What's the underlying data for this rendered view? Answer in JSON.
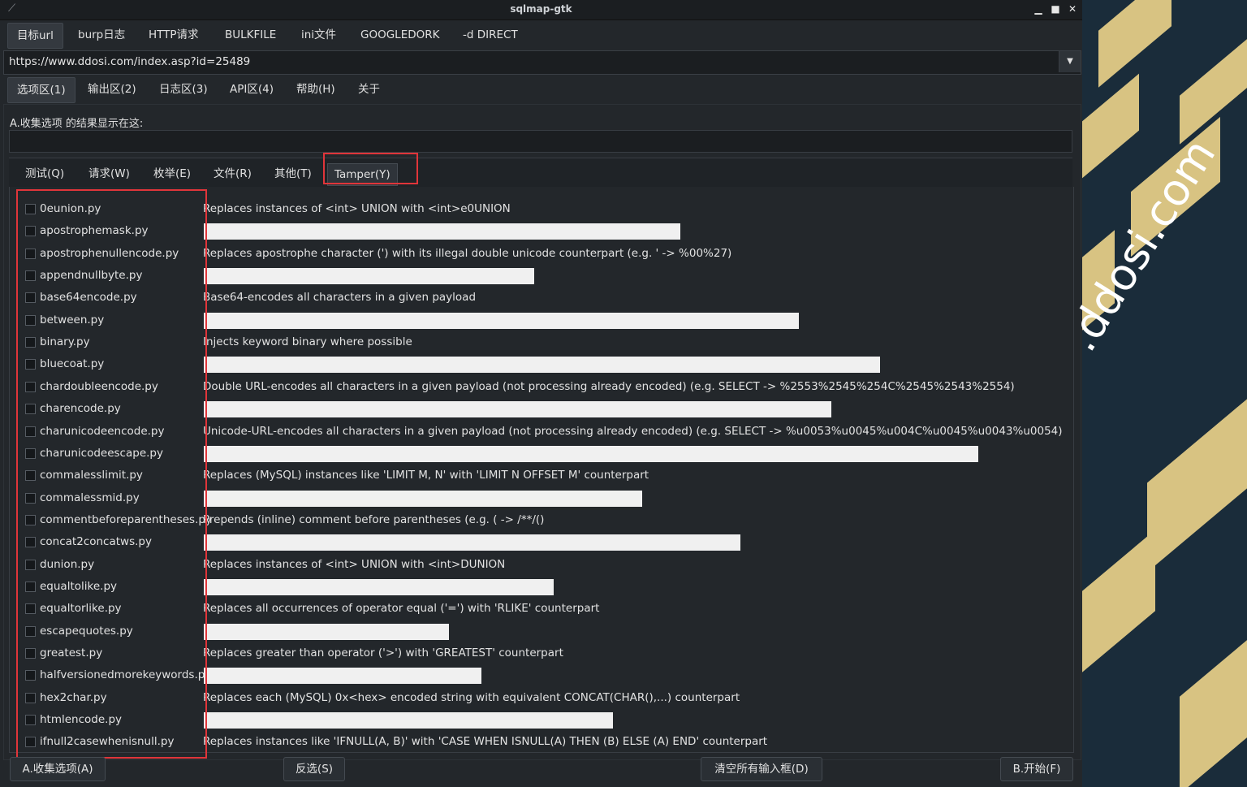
{
  "window": {
    "title": "sqlmap-gtk"
  },
  "top_tabs": [
    "目标url",
    "burp日志",
    "HTTP请求",
    "BULKFILE",
    "ini文件",
    "GOOGLEDORK",
    "-d DIRECT"
  ],
  "url": {
    "value": "https://www.ddosi.com/index.asp?id=25489"
  },
  "section_tabs": [
    "选项区(1)",
    "输出区(2)",
    "日志区(3)",
    "API区(4)",
    "帮助(H)",
    "关于"
  ],
  "collect": {
    "label": "A.收集选项 的结果显示在这:"
  },
  "inner_tabs": [
    "测试(Q)",
    "请求(W)",
    "枚举(E)",
    "文件(R)",
    "其他(T)",
    "Tamper(Y)"
  ],
  "tampers": [
    {
      "name": "0eunion.py",
      "desc": "Replaces instances of <int> UNION with <int>e0UNION"
    },
    {
      "name": "apostrophemask.py",
      "desc": ""
    },
    {
      "name": "apostrophenullencode.py",
      "desc": "Replaces apostrophe character (') with its illegal double unicode counterpart (e.g. ' -> %00%27)"
    },
    {
      "name": "appendnullbyte.py",
      "desc": ""
    },
    {
      "name": "base64encode.py",
      "desc": "Base64-encodes all characters in a given payload"
    },
    {
      "name": "between.py",
      "desc": ""
    },
    {
      "name": "binary.py",
      "desc": "Injects keyword binary where possible"
    },
    {
      "name": "bluecoat.py",
      "desc": ""
    },
    {
      "name": "chardoubleencode.py",
      "desc": "Double URL-encodes all characters in a given payload (not processing already encoded) (e.g. SELECT -> %2553%2545%254C%2545%2543%2554)"
    },
    {
      "name": "charencode.py",
      "desc": ""
    },
    {
      "name": "charunicodeencode.py",
      "desc": "Unicode-URL-encodes all characters in a given payload (not processing already encoded) (e.g. SELECT -> %u0053%u0045%u004C%u0045%u0043%u0054)"
    },
    {
      "name": "charunicodeescape.py",
      "desc": ""
    },
    {
      "name": "commalesslimit.py",
      "desc": "Replaces (MySQL) instances like 'LIMIT M, N' with 'LIMIT N OFFSET M' counterpart"
    },
    {
      "name": "commalessmid.py",
      "desc": ""
    },
    {
      "name": "commentbeforeparentheses.py",
      "desc": "Prepends (inline) comment before parentheses (e.g. ( -> /**/()"
    },
    {
      "name": "concat2concatws.py",
      "desc": ""
    },
    {
      "name": "dunion.py",
      "desc": "Replaces instances of <int> UNION with <int>DUNION"
    },
    {
      "name": "equaltolike.py",
      "desc": ""
    },
    {
      "name": "equaltorlike.py",
      "desc": "Replaces all occurrences of operator equal ('=') with 'RLIKE' counterpart"
    },
    {
      "name": "escapequotes.py",
      "desc": ""
    },
    {
      "name": "greatest.py",
      "desc": "Replaces greater than operator ('>') with 'GREATEST' counterpart"
    },
    {
      "name": "halfversionedmorekeywords.py",
      "desc": ""
    },
    {
      "name": "hex2char.py",
      "desc": "Replaces each (MySQL) 0x<hex> encoded string with equivalent CONCAT(CHAR(),...) counterpart"
    },
    {
      "name": "htmlencode.py",
      "desc": ""
    },
    {
      "name": "ifnull2casewhenisnull.py",
      "desc": "Replaces instances like 'IFNULL(A, B)' with 'CASE WHEN ISNULL(A) THEN (B) ELSE (A) END' counterpart"
    }
  ],
  "buttons": {
    "collect": "A.收集选项(A)",
    "invert": "反选(S)",
    "clear": "清空所有输入框(D)",
    "start": "B.开始(F)"
  },
  "watermark": ".ddosi.com"
}
